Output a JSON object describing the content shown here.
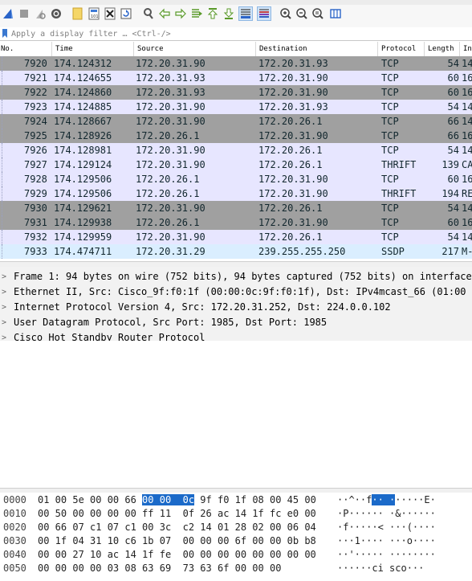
{
  "toolbar": {
    "icons": [
      "shark-fin-start-icon",
      "stop-square-icon",
      "restart-fin-icon",
      "options-gear-icon",
      "open-folder-icon",
      "save-file-icon",
      "close-file-icon",
      "reload-icon",
      "find-icon",
      "back-arrow-icon",
      "forward-arrow-icon",
      "go-to-packet-icon",
      "first-packet-icon",
      "last-packet-icon",
      "autoscroll-icon",
      "colorize-icon",
      "zoom-in-icon",
      "zoom-out-icon",
      "normal-size-icon",
      "resize-columns-icon"
    ]
  },
  "filter": {
    "placeholder": "Apply a display filter … <Ctrl-/>"
  },
  "packet_list": {
    "columns": [
      "No.",
      "Time",
      "Source",
      "Destination",
      "Protocol",
      "Length",
      "In"
    ],
    "rows": [
      {
        "no": "7920",
        "time": "174.124312",
        "source": "172.20.31.90",
        "destination": "172.20.31.93",
        "protocol": "TCP",
        "length": "54",
        "info": "14",
        "color": "gray"
      },
      {
        "no": "7921",
        "time": "174.124655",
        "source": "172.20.31.93",
        "destination": "172.20.31.90",
        "protocol": "TCP",
        "length": "60",
        "info": "16",
        "color": "lav"
      },
      {
        "no": "7922",
        "time": "174.124860",
        "source": "172.20.31.93",
        "destination": "172.20.31.90",
        "protocol": "TCP",
        "length": "60",
        "info": "16",
        "color": "gray"
      },
      {
        "no": "7923",
        "time": "174.124885",
        "source": "172.20.31.90",
        "destination": "172.20.31.93",
        "protocol": "TCP",
        "length": "54",
        "info": "14",
        "color": "lav"
      },
      {
        "no": "7924",
        "time": "174.128667",
        "source": "172.20.31.90",
        "destination": "172.20.26.1",
        "protocol": "TCP",
        "length": "66",
        "info": "14",
        "color": "gray"
      },
      {
        "no": "7925",
        "time": "174.128926",
        "source": "172.20.26.1",
        "destination": "172.20.31.90",
        "protocol": "TCP",
        "length": "66",
        "info": "16",
        "color": "gray"
      },
      {
        "no": "7926",
        "time": "174.128981",
        "source": "172.20.31.90",
        "destination": "172.20.26.1",
        "protocol": "TCP",
        "length": "54",
        "info": "14",
        "color": "lav"
      },
      {
        "no": "7927",
        "time": "174.129124",
        "source": "172.20.31.90",
        "destination": "172.20.26.1",
        "protocol": "THRIFT",
        "length": "139",
        "info": "CA",
        "color": "lav"
      },
      {
        "no": "7928",
        "time": "174.129506",
        "source": "172.20.26.1",
        "destination": "172.20.31.90",
        "protocol": "TCP",
        "length": "60",
        "info": "16",
        "color": "lav"
      },
      {
        "no": "7929",
        "time": "174.129506",
        "source": "172.20.26.1",
        "destination": "172.20.31.90",
        "protocol": "THRIFT",
        "length": "194",
        "info": "RE",
        "color": "lav"
      },
      {
        "no": "7930",
        "time": "174.129621",
        "source": "172.20.31.90",
        "destination": "172.20.26.1",
        "protocol": "TCP",
        "length": "54",
        "info": "14",
        "color": "gray"
      },
      {
        "no": "7931",
        "time": "174.129938",
        "source": "172.20.26.1",
        "destination": "172.20.31.90",
        "protocol": "TCP",
        "length": "60",
        "info": "16",
        "color": "gray"
      },
      {
        "no": "7932",
        "time": "174.129959",
        "source": "172.20.31.90",
        "destination": "172.20.26.1",
        "protocol": "TCP",
        "length": "54",
        "info": "14",
        "color": "lav"
      },
      {
        "no": "7933",
        "time": "174.474711",
        "source": "172.20.31.29",
        "destination": "239.255.255.250",
        "protocol": "SSDP",
        "length": "217",
        "info": "M-",
        "color": "ssdp"
      }
    ]
  },
  "details": [
    "Frame 1: 94 bytes on wire (752 bits), 94 bytes captured (752 bits) on interface",
    "Ethernet II, Src: Cisco_9f:f0:1f (00:00:0c:9f:f0:1f), Dst: IPv4mcast_66 (01:00",
    "Internet Protocol Version 4, Src: 172.20.31.252, Dst: 224.0.0.102",
    "User Datagram Protocol, Src Port: 1985, Dst Port: 1985",
    "Cisco Hot Standby Router Protocol"
  ],
  "bytes": [
    {
      "offset": "0000",
      "hex_a": "01 00 5e 00 00 66 ",
      "hex_hl": "00 00  0c",
      "hex_b": " 9f f0 1f 08 00 45 00",
      "ascii_a": "··^··f",
      "ascii_hl": "·· ·",
      "ascii_b": "·····E·"
    },
    {
      "offset": "0010",
      "hex_a": "00 50 00 00 00 00 ff 11  0f 26 ac 14 1f fc e0 00",
      "hex_hl": "",
      "hex_b": "",
      "ascii_a": "·P······ ·&······",
      "ascii_hl": "",
      "ascii_b": ""
    },
    {
      "offset": "0020",
      "hex_a": "00 66 07 c1 07 c1 00 3c  c2 14 01 28 02 00 06 04",
      "hex_hl": "",
      "hex_b": "",
      "ascii_a": "·f·····< ···(····",
      "ascii_hl": "",
      "ascii_b": ""
    },
    {
      "offset": "0030",
      "hex_a": "00 1f 04 31 10 c6 1b 07  00 00 00 6f 00 00 0b b8",
      "hex_hl": "",
      "hex_b": "",
      "ascii_a": "···1···· ···o····",
      "ascii_hl": "",
      "ascii_b": ""
    },
    {
      "offset": "0040",
      "hex_a": "00 00 27 10 ac 14 1f fe  00 00 00 00 00 00 00 00",
      "hex_hl": "",
      "hex_b": "",
      "ascii_a": "··'····· ········",
      "ascii_hl": "",
      "ascii_b": ""
    },
    {
      "offset": "0050",
      "hex_a": "00 00 00 00 03 08 63 69  73 63 6f 00 00 00",
      "hex_hl": "",
      "hex_b": "",
      "ascii_a": "······ci sco···",
      "ascii_hl": "",
      "ascii_b": ""
    }
  ]
}
